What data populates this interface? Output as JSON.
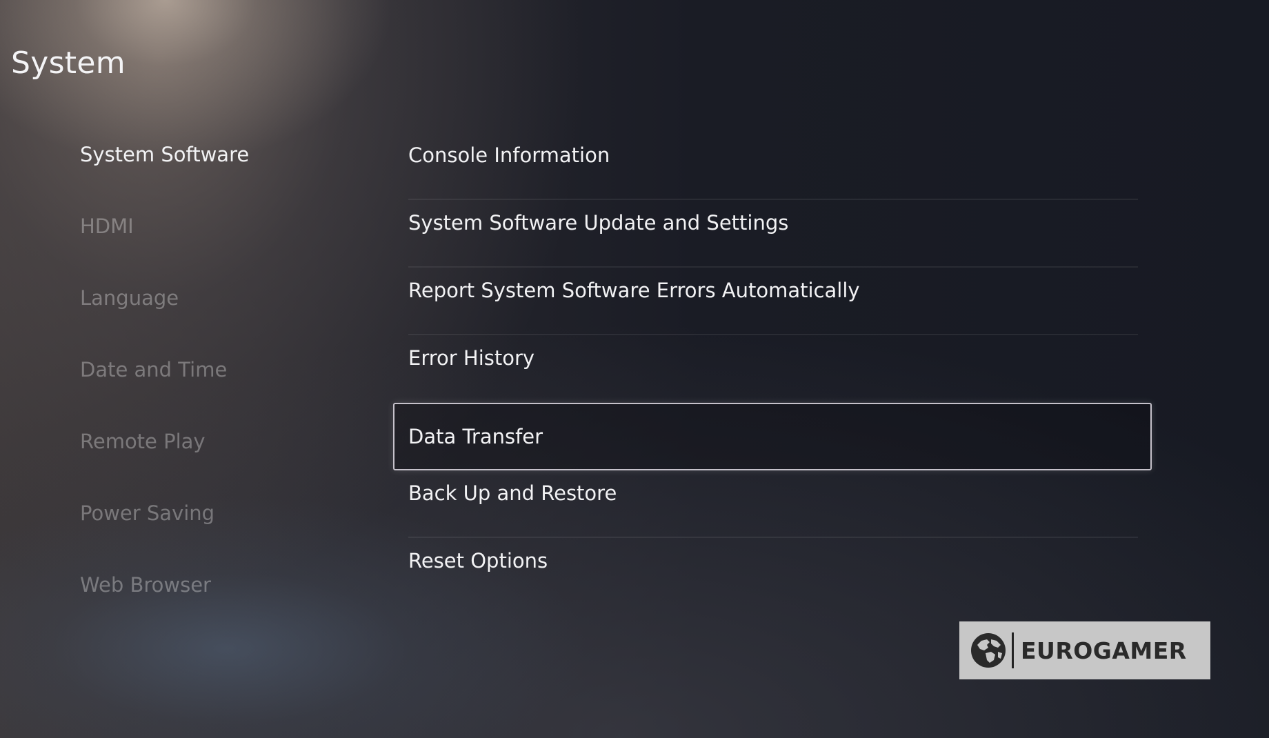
{
  "page": {
    "title": "System"
  },
  "sidebar": {
    "items": [
      {
        "label": "System Software",
        "active": true
      },
      {
        "label": "HDMI",
        "active": false
      },
      {
        "label": "Language",
        "active": false
      },
      {
        "label": "Date and Time",
        "active": false
      },
      {
        "label": "Remote Play",
        "active": false
      },
      {
        "label": "Power Saving",
        "active": false
      },
      {
        "label": "Web Browser",
        "active": false
      }
    ]
  },
  "menu": {
    "items": [
      {
        "label": "Console Information"
      },
      {
        "label": "System Software Update and Settings"
      },
      {
        "label": "Report System Software Errors Automatically"
      },
      {
        "label": "Error History"
      },
      {
        "label": "Data Transfer",
        "focused": true
      },
      {
        "label": "Back Up and Restore"
      },
      {
        "label": "Reset Options"
      }
    ]
  },
  "watermark": {
    "text": "EUROGAMER",
    "icon": "globe-icon"
  },
  "colors": {
    "text_primary": "#f2f2f4",
    "text_dimmed": "rgba(255,255,255,0.32)",
    "focus_border": "#c6c2cb",
    "watermark_bg": "#c7c7c7"
  }
}
